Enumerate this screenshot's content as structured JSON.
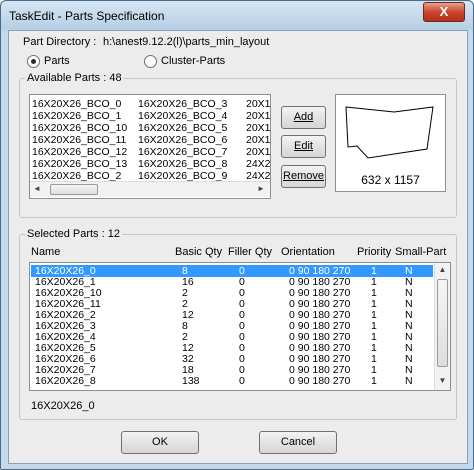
{
  "window": {
    "title": "TaskEdit - Parts Specification",
    "close": "X"
  },
  "part_directory": {
    "label": "Part Directory :",
    "value": "h:\\anest9.12.2(l)\\parts_min_layout"
  },
  "mode": {
    "parts_label": "Parts",
    "cluster_label": "Cluster-Parts",
    "selected": "Parts"
  },
  "available": {
    "label": "Available Parts : 48",
    "col1": [
      "16X20X26_BCO_0",
      "16X20X26_BCO_1",
      "16X20X26_BCO_10",
      "16X20X26_BCO_11",
      "16X20X26_BCO_12",
      "16X20X26_BCO_13",
      "16X20X26_BCO_2"
    ],
    "col2": [
      "16X20X26_BCO_3",
      "16X20X26_BCO_4",
      "16X20X26_BCO_5",
      "16X20X26_BCO_6",
      "16X20X26_BCO_7",
      "16X20X26_BCO_8",
      "16X20X26_BCO_9"
    ],
    "col3": [
      "20X1",
      "20X1",
      "20X1",
      "20X1",
      "20X1",
      "24X2",
      "24X2"
    ],
    "scroll_left": "◄",
    "scroll_right": "►"
  },
  "buttons": {
    "add": "Add",
    "edit": "Edit",
    "remove": "Remove",
    "ok": "OK",
    "cancel": "Cancel"
  },
  "preview": {
    "size": "632 x 1157"
  },
  "selected": {
    "label": "Selected Parts : 12",
    "headers": {
      "name": "Name",
      "basic_qty": "Basic Qty",
      "filler_qty": "Filler Qty",
      "orientation": "Orientation",
      "priority": "Priority",
      "small_part": "Small-Part"
    },
    "rows": [
      {
        "name": "16X20X26_0",
        "basic": "8",
        "filler": "0",
        "orient": "0 90 180 270",
        "priority": "1",
        "small": "N"
      },
      {
        "name": "16X20X26_1",
        "basic": "16",
        "filler": "0",
        "orient": "0 90 180 270",
        "priority": "1",
        "small": "N"
      },
      {
        "name": "16X20X26_10",
        "basic": "2",
        "filler": "0",
        "orient": "0 90 180 270",
        "priority": "1",
        "small": "N"
      },
      {
        "name": "16X20X26_11",
        "basic": "2",
        "filler": "0",
        "orient": "0 90 180 270",
        "priority": "1",
        "small": "N"
      },
      {
        "name": "16X20X26_2",
        "basic": "12",
        "filler": "0",
        "orient": "0 90 180 270",
        "priority": "1",
        "small": "N"
      },
      {
        "name": "16X20X26_3",
        "basic": "8",
        "filler": "0",
        "orient": "0 90 180 270",
        "priority": "1",
        "small": "N"
      },
      {
        "name": "16X20X26_4",
        "basic": "2",
        "filler": "0",
        "orient": "0 90 180 270",
        "priority": "1",
        "small": "N"
      },
      {
        "name": "16X20X26_5",
        "basic": "12",
        "filler": "0",
        "orient": "0 90 180 270",
        "priority": "1",
        "small": "N"
      },
      {
        "name": "16X20X26_6",
        "basic": "32",
        "filler": "0",
        "orient": "0 90 180 270",
        "priority": "1",
        "small": "N"
      },
      {
        "name": "16X20X26_7",
        "basic": "18",
        "filler": "0",
        "orient": "0 90 180 270",
        "priority": "1",
        "small": "N"
      },
      {
        "name": "16X20X26_8",
        "basic": "138",
        "filler": "0",
        "orient": "0 90 180 270",
        "priority": "1",
        "small": "N"
      }
    ],
    "scroll_up": "▲",
    "scroll_down": "▼"
  },
  "status": {
    "current_part": "16X20X26_0"
  }
}
